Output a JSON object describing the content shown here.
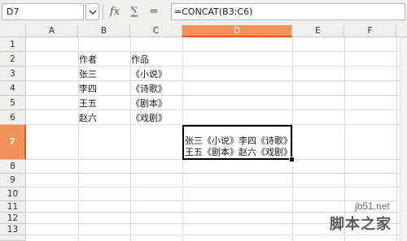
{
  "formula_bar": {
    "name_box": "D7",
    "function_wizard_icon": "fx-icon",
    "sum_icon": "sigma-icon",
    "formula_icon": "equals-icon",
    "formula_wizard_label": "fx",
    "sum_label": "∑",
    "equals_label": "=",
    "formula": "=CONCAT(B3:C6)"
  },
  "columns": [
    "A",
    "B",
    "C",
    "D",
    "E",
    "F"
  ],
  "selected_column": "D",
  "rows": [
    "1",
    "2",
    "3",
    "4",
    "5",
    "6",
    "7",
    "8",
    "9",
    "10",
    "11",
    "12",
    "13"
  ],
  "selected_row": "7",
  "cells": {
    "B2": "作者",
    "C2": "作品",
    "B3": "张三",
    "C3": "《小说》",
    "B4": "李四",
    "C4": "《诗歌》",
    "B5": "王五",
    "C5": "《剧本》",
    "B6": "赵六",
    "C6": "《戏剧》",
    "D7_line1": "张三《小说》李四《诗歌》",
    "D7_line2": "王五《剧本》赵六《戏剧》"
  },
  "watermark": {
    "line1": "jb51.net",
    "line2": "脚本之家"
  }
}
